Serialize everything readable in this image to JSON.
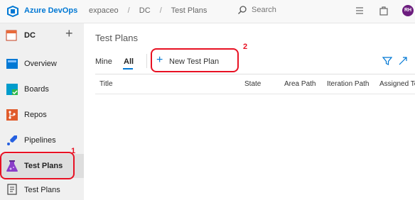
{
  "topbar": {
    "brand": "Azure DevOps",
    "breadcrumbs": [
      "expaceo",
      "DC",
      "Test Plans"
    ],
    "separator": "/",
    "search_placeholder": "Search",
    "avatar_initials": "RH",
    "accent_color": "#0078d4"
  },
  "sidebar": {
    "project_name": "DC",
    "add_symbol": "+",
    "items": [
      {
        "label": "Overview",
        "icon": "overview-icon"
      },
      {
        "label": "Boards",
        "icon": "boards-icon"
      },
      {
        "label": "Repos",
        "icon": "repos-icon"
      },
      {
        "label": "Pipelines",
        "icon": "pipelines-icon"
      },
      {
        "label": "Test Plans",
        "icon": "test-plans-icon",
        "active": true
      },
      {
        "label": "Test Plans",
        "icon": "test-plans-sub-icon"
      }
    ]
  },
  "main": {
    "title": "Test Plans",
    "tabs": [
      {
        "label": "Mine"
      },
      {
        "label": "All",
        "selected": true
      }
    ],
    "new_plan_symbol": "+",
    "new_plan_label": "New Test Plan",
    "columns": [
      "Title",
      "State",
      "Area Path",
      "Iteration Path",
      "Assigned To"
    ]
  },
  "annotations": {
    "step1": "1",
    "step2": "2",
    "color": "#e81123"
  }
}
